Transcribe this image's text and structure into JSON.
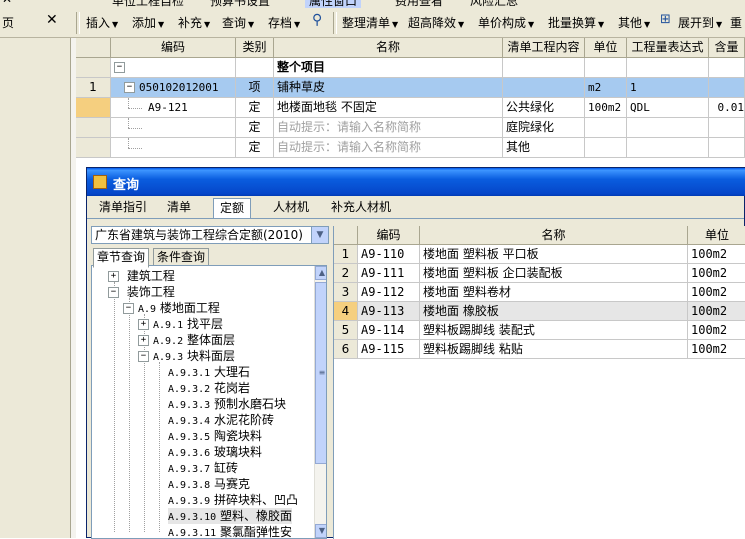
{
  "toolbar": {
    "top_items": [
      "单位工程自检",
      "预算书设置",
      "属性窗口",
      "费用查看",
      "风险汇总"
    ],
    "close_glyph": "✕",
    "items": [
      {
        "label": "插入",
        "dropdown": true
      },
      {
        "label": "添加",
        "dropdown": true
      },
      {
        "label": "补充",
        "dropdown": true
      },
      {
        "label": "查询",
        "dropdown": true
      },
      {
        "label": "存档",
        "dropdown": true
      },
      {
        "label": "整理清单",
        "dropdown": true
      },
      {
        "label": "超高降效",
        "dropdown": true
      },
      {
        "label": "单价构成",
        "dropdown": true
      },
      {
        "label": "批量换算",
        "dropdown": true
      },
      {
        "label": "其他",
        "dropdown": true
      },
      {
        "label": "展开到",
        "dropdown": true
      },
      {
        "label": "重",
        "dropdown": false
      }
    ]
  },
  "main_grid": {
    "headers": [
      "编码",
      "类别",
      "名称",
      "清单工程内容",
      "单位",
      "工程量表达式",
      "含量"
    ],
    "rows": [
      {
        "num": "",
        "code": "",
        "type": "",
        "name": "整个项目",
        "content": "",
        "unit": "",
        "expr": "",
        "qty": "",
        "expander": "−"
      },
      {
        "num": "1",
        "code": "050102012001",
        "type": "项",
        "name": "铺种草皮",
        "content": "",
        "unit": "m2",
        "expr": "1",
        "qty": "",
        "expander": "−"
      },
      {
        "num": "",
        "code": "A9-121",
        "type": "定",
        "name": "地楼面地毯 不固定",
        "content": "公共绿化",
        "unit": "100m2",
        "expr": "QDL",
        "qty": "0.01"
      },
      {
        "num": "",
        "code": "",
        "type": "定",
        "name": "自动提示：请输入名称简称",
        "content": "庭院绿化",
        "unit": "",
        "expr": "",
        "qty": ""
      },
      {
        "num": "",
        "code": "",
        "type": "定",
        "name": "自动提示：请输入名称简称",
        "content": "其他",
        "unit": "",
        "expr": "",
        "qty": ""
      }
    ]
  },
  "dialog": {
    "title": "查询",
    "tabs": [
      "清单指引",
      "清单",
      "定额",
      "人材机",
      "补充人材机"
    ],
    "active_tab": "定额",
    "quota_library": "广东省建筑与装饰工程综合定额(2010)",
    "search_tabs": [
      "章节查询",
      "条件查询"
    ],
    "tree": [
      {
        "label": "建筑工程",
        "code": "",
        "expander": "+"
      },
      {
        "label": "装饰工程",
        "code": "",
        "expander": "−"
      },
      {
        "label": "楼地面工程",
        "code": "A.9",
        "expander": "−"
      },
      {
        "label": "找平层",
        "code": "A.9.1",
        "expander": "+"
      },
      {
        "label": "整体面层",
        "code": "A.9.2",
        "expander": "+"
      },
      {
        "label": "块料面层",
        "code": "A.9.3",
        "expander": "−"
      },
      {
        "label": "大理石",
        "code": "A.9.3.1",
        "expander": ""
      },
      {
        "label": "花岗岩",
        "code": "A.9.3.2",
        "expander": ""
      },
      {
        "label": "预制水磨石块",
        "code": "A.9.3.3",
        "expander": ""
      },
      {
        "label": "水泥花阶砖",
        "code": "A.9.3.4",
        "expander": ""
      },
      {
        "label": "陶瓷块料",
        "code": "A.9.3.5",
        "expander": ""
      },
      {
        "label": "玻璃块料",
        "code": "A.9.3.6",
        "expander": ""
      },
      {
        "label": "缸砖",
        "code": "A.9.3.7",
        "expander": ""
      },
      {
        "label": "马赛克",
        "code": "A.9.3.8",
        "expander": ""
      },
      {
        "label": "拼碎块料、凹凸",
        "code": "A.9.3.9",
        "expander": ""
      },
      {
        "label": "塑料、橡胶面",
        "code": "A.9.3.10",
        "expander": ""
      },
      {
        "label": "聚氯酯弹性安",
        "code": "A.9.3.11",
        "expander": ""
      }
    ],
    "results": {
      "headers": [
        "编码",
        "名称",
        "单位"
      ],
      "rows": [
        {
          "num": "1",
          "code": "A9-110",
          "name": "楼地面 塑料板 平口板",
          "unit": "100m2"
        },
        {
          "num": "2",
          "code": "A9-111",
          "name": "楼地面 塑料板 企口装配板",
          "unit": "100m2"
        },
        {
          "num": "3",
          "code": "A9-112",
          "name": "楼地面 塑料卷材",
          "unit": "100m2"
        },
        {
          "num": "4",
          "code": "A9-113",
          "name": "楼地面 橡胶板",
          "unit": "100m2"
        },
        {
          "num": "5",
          "code": "A9-114",
          "name": "塑料板踢脚线 装配式",
          "unit": "100m2"
        },
        {
          "num": "6",
          "code": "A9-115",
          "name": "塑料板踢脚线 粘贴",
          "unit": "100m2"
        }
      ],
      "selected_row": 4
    }
  }
}
